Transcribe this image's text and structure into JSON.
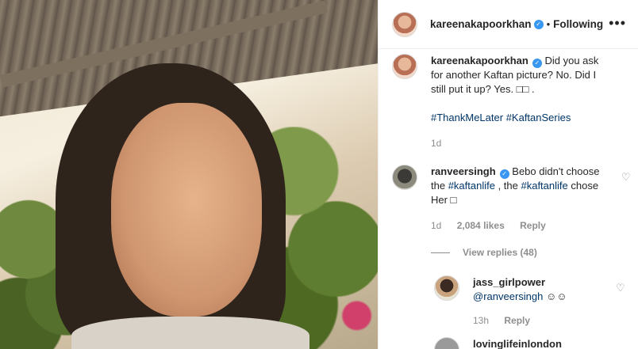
{
  "post": {
    "username": "kareenakapoorkhan",
    "follow_state": "Following",
    "separator": "•"
  },
  "caption": {
    "username": "kareenakapoorkhan",
    "text": "Did you ask for another Kaftan picture? No. Did I still put it up? Yes. □□ .",
    "hashtags": [
      "#ThankMeLater",
      "#KaftanSeries"
    ],
    "time": "1d"
  },
  "comments": [
    {
      "username": "ranveersingh",
      "text_1": "Bebo didn't choose the ",
      "hashtag_1": "#kaftanlife",
      "text_2": " , the ",
      "hashtag_2": "#kaftanlife",
      "text_3": " chose Her □",
      "time": "1d",
      "likes": "2,084 likes",
      "reply_label": "Reply"
    }
  ],
  "view_replies_label": "View replies (48)",
  "replies": [
    {
      "username": "jass_girlpower",
      "mention": "@ranveersingh",
      "text": " ☺☺",
      "time": "13h",
      "reply_label": "Reply"
    }
  ],
  "partial_next_username": "lovinglifeinlondon",
  "icons": {
    "verified": "verified-badge-icon",
    "more": "more-options-icon",
    "heart": "heart-outline-icon"
  },
  "colors": {
    "link": "#003569",
    "verified": "#3897f0",
    "muted": "#8e8e8e"
  }
}
